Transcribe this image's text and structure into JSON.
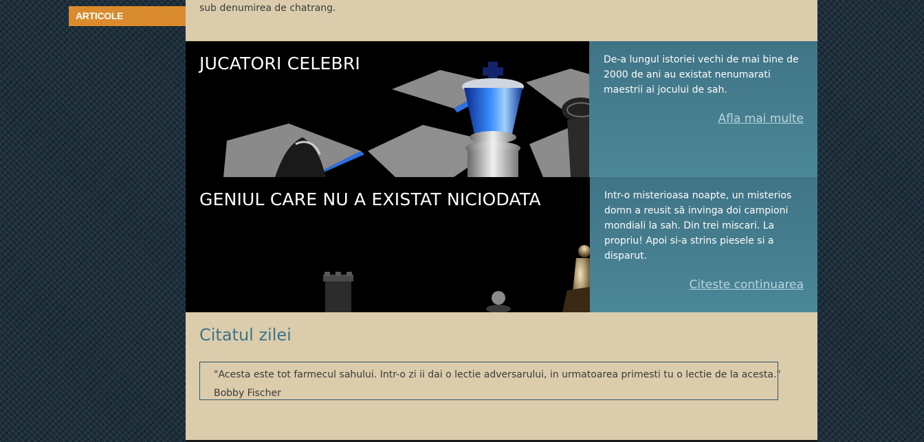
{
  "sidebar": {
    "tab_label": "ARTICOLE"
  },
  "main": {
    "intro_tail": "sub denumirea de chatrang."
  },
  "features": [
    {
      "title": "JUCATORI CELEBRI",
      "description": "De-a lungul istoriei vechi de mai bine de 2000 de ani au existat nenumarati maestrii ai jocului de sah.",
      "link": "Afla mai multe"
    },
    {
      "title": "GENIUL CARE NU A EXISTAT NICIODATA",
      "description": "Intr-o misterioasa noapte, un misterios domn a reusit să invinga doi campioni mondiali la sah. Din trei miscari. La propriu! Apoi si-a strins piesele si a disparut.",
      "link": "Citeste continuarea"
    }
  ],
  "quote": {
    "heading": "Citatul zilei",
    "text": "\"Acesta este tot farmecul sahului. Intr-o zi ii dai o lectie adversarului, in urmatoarea primesti tu o lectie de la acesta.\"",
    "author": "Bobby Fischer"
  },
  "colors": {
    "accent_orange": "#d98b2e",
    "panel_teal": "#4b8797",
    "page_beige": "#dbcdab",
    "heading_teal": "#3f7487",
    "link_color": "#b9d4df"
  }
}
